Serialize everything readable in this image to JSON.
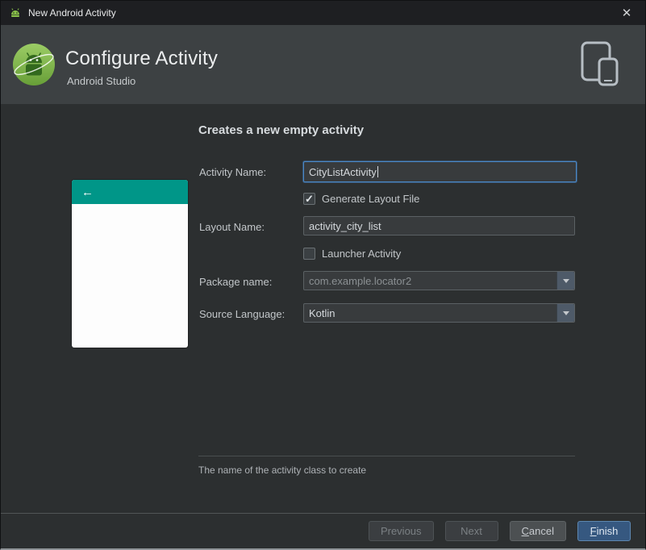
{
  "window": {
    "title": "New Android Activity",
    "close_glyph": "✕"
  },
  "header": {
    "title": "Configure Activity",
    "subtitle": "Android Studio"
  },
  "main": {
    "heading": "Creates a new empty activity",
    "preview": {
      "back_glyph": "←"
    },
    "form": {
      "activity_name": {
        "label": "Activity Name:",
        "value": "CityListActivity"
      },
      "generate_layout": {
        "label": "Generate Layout File",
        "check_glyph": "✓"
      },
      "layout_name": {
        "label": "Layout Name:",
        "value": "activity_city_list"
      },
      "launcher_activity": {
        "label": "Launcher Activity",
        "check_glyph": ""
      },
      "package_name": {
        "label": "Package name:",
        "value": "com.example.locator2"
      },
      "source_language": {
        "label": "Source Language:",
        "value": "Kotlin"
      }
    },
    "hint": "The name of the activity class to create"
  },
  "footer": {
    "previous_label": "Previous",
    "next_label": "Next",
    "cancel_label": "Cancel",
    "finish_label": "Finish"
  },
  "colors": {
    "preview_appbar_teal": "#009688",
    "focus_border_blue": "#4a88c7",
    "finish_button_blue": "#365880",
    "android_green": "#8ac24a",
    "header_gray": "#3d4143",
    "body_gray": "#2c2f30"
  }
}
